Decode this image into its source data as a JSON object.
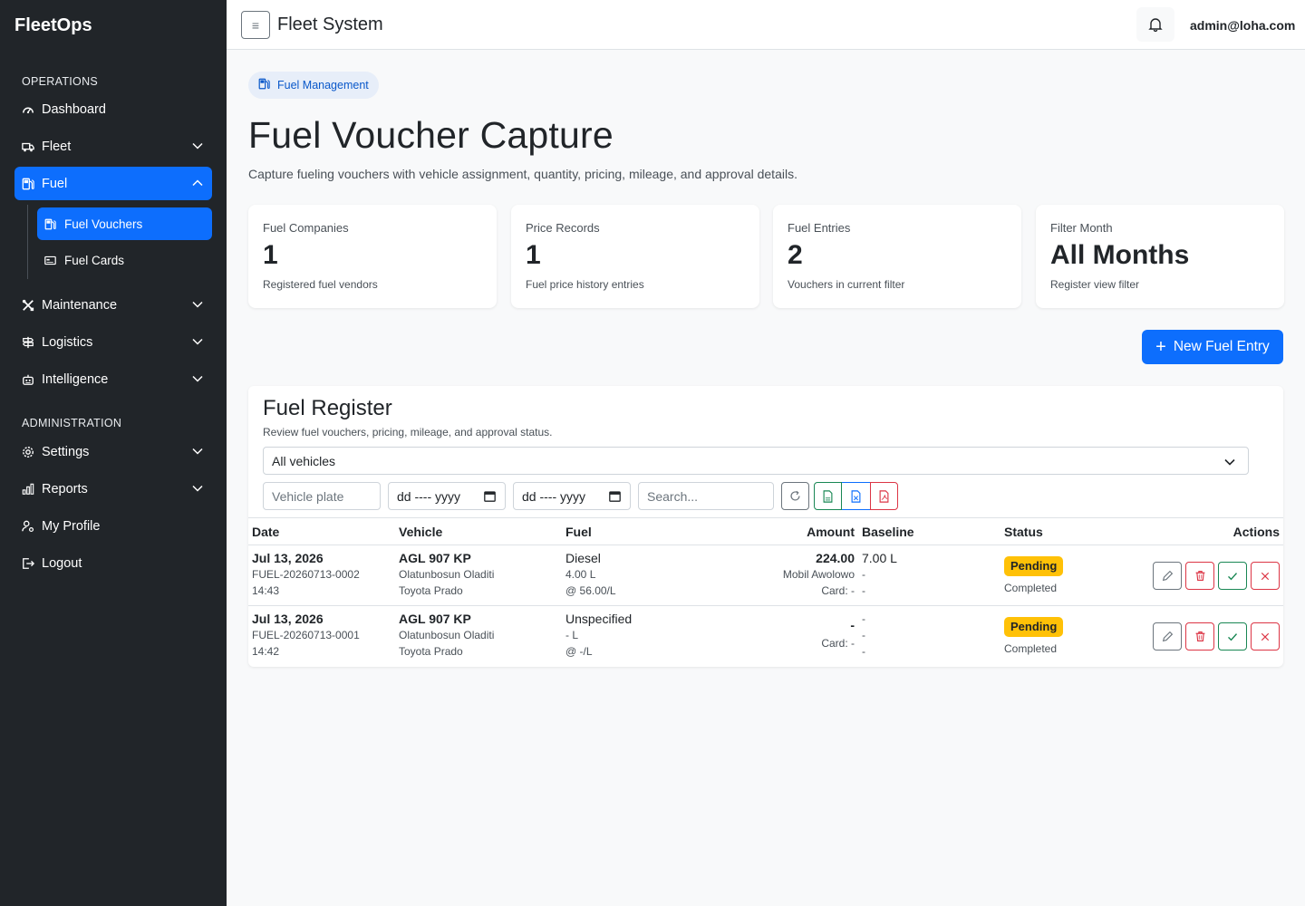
{
  "sidebar": {
    "brand": "FleetOps",
    "sections": {
      "operations": "OPERATIONS",
      "administration": "ADMINISTRATION"
    },
    "items": {
      "dashboard": "Dashboard",
      "fleet": "Fleet",
      "fuel": "Fuel",
      "fuel_vouchers": "Fuel Vouchers",
      "fuel_cards": "Fuel Cards",
      "maintenance": "Maintenance",
      "logistics": "Logistics",
      "intelligence": "Intelligence",
      "settings": "Settings",
      "reports": "Reports",
      "my_profile": "My Profile",
      "logout": "Logout"
    },
    "active_color": "#0d6efd",
    "bg_color": "#212529"
  },
  "topbar": {
    "menu_glyph": "≡",
    "title": "Fleet System",
    "user_email": "admin@loha.com"
  },
  "header": {
    "badge": "Fuel Management",
    "title": "Fuel Voucher Capture",
    "subtitle": "Capture fueling vouchers with vehicle assignment, quantity, pricing, mileage, and approval details."
  },
  "stats": [
    {
      "label": "Fuel Companies",
      "value": "1",
      "note": "Registered fuel vendors"
    },
    {
      "label": "Price Records",
      "value": "1",
      "note": "Fuel price history entries"
    },
    {
      "label": "Fuel Entries",
      "value": "2",
      "note": "Vouchers in current filter"
    },
    {
      "label": "Filter Month",
      "value": "All Months",
      "note": "Register view filter"
    }
  ],
  "new_entry": {
    "plus": "+",
    "label": "New Fuel Entry"
  },
  "register": {
    "title": "Fuel Register",
    "subtitle": "Review fuel vouchers, pricing, mileage, and approval status.",
    "vehicle_select": "All vehicles",
    "filters": {
      "plate_placeholder": "Vehicle plate",
      "date_from": "dd ---- yyyy",
      "date_to": "dd ---- yyyy",
      "search_placeholder": "Search..."
    },
    "columns": {
      "date": "Date",
      "vehicle": "Vehicle",
      "fuel": "Fuel",
      "amount": "Amount",
      "baseline": "Baseline",
      "status": "Status",
      "actions": "Actions"
    },
    "rows": [
      {
        "date": "Jul 13, 2026",
        "ref": "FUEL-20260713-0002",
        "time": "14:43",
        "plate": "AGL 907 KP",
        "driver": "Olatunbosun Oladiti",
        "model": "Toyota Prado",
        "fuel": "Diesel",
        "qty": "4.00 L",
        "price": "@ 56.00/L",
        "amount": "224.00",
        "vendor": "Mobil Awolowo",
        "card": "Card: -",
        "baseline": "7.00 L",
        "base2": "-",
        "base3": "-",
        "status": "Pending",
        "status_sub": "Completed"
      },
      {
        "date": "Jul 13, 2026",
        "ref": "FUEL-20260713-0001",
        "time": "14:42",
        "plate": "AGL 907 KP",
        "driver": "Olatunbosun Oladiti",
        "model": "Toyota Prado",
        "fuel": "Unspecified",
        "qty": "- L",
        "price": "@ -/L",
        "amount": "-",
        "vendor": "",
        "card": "Card: -",
        "baseline": "-",
        "base2": "-",
        "base3": "-",
        "status": "Pending",
        "status_sub": "Completed"
      }
    ]
  },
  "colors": {
    "primary": "#0d6efd",
    "warning": "#ffc107",
    "danger": "#dc3545",
    "success": "#198754"
  }
}
